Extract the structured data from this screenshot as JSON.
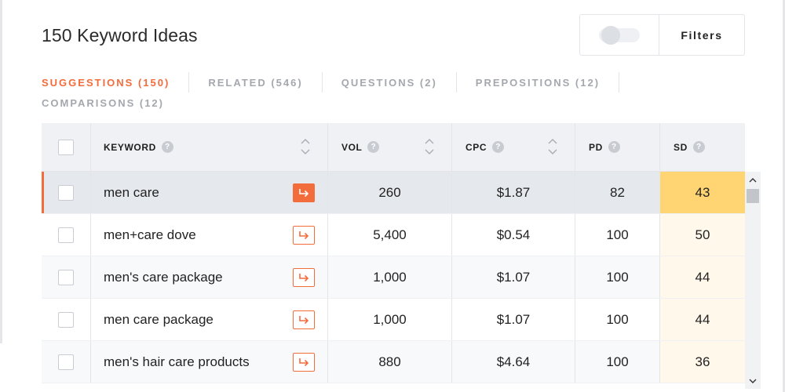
{
  "title": "150 Keyword Ideas",
  "filters": {
    "label": "Filters",
    "toggle_on": false
  },
  "tabs": [
    {
      "label": "SUGGESTIONS (150)",
      "active": true
    },
    {
      "label": "RELATED (546)",
      "active": false
    },
    {
      "label": "QUESTIONS (2)",
      "active": false
    },
    {
      "label": "PREPOSITIONS (12)",
      "active": false
    },
    {
      "label": "COMPARISONS (12)",
      "active": false
    }
  ],
  "table": {
    "headers": {
      "keyword": "KEYWORD",
      "vol": "VOL",
      "cpc": "CPC",
      "pd": "PD",
      "sd": "SD"
    },
    "rows": [
      {
        "keyword": "men care",
        "vol": "260",
        "cpc": "$1.87",
        "pd": "82",
        "sd": "43"
      },
      {
        "keyword": "men+care dove",
        "vol": "5,400",
        "cpc": "$0.54",
        "pd": "100",
        "sd": "50"
      },
      {
        "keyword": "men's care package",
        "vol": "1,000",
        "cpc": "$1.07",
        "pd": "100",
        "sd": "44"
      },
      {
        "keyword": "men care package",
        "vol": "1,000",
        "cpc": "$1.07",
        "pd": "100",
        "sd": "44"
      },
      {
        "keyword": "men's hair care products",
        "vol": "880",
        "cpc": "$4.64",
        "pd": "100",
        "sd": "36"
      }
    ]
  },
  "colors": {
    "accent": "#f26c3c",
    "sd_highlight": "#ffd472",
    "sd_light": "#fff8eb"
  },
  "icons": {
    "help": "question-circle-icon",
    "sort": "sort-chevrons-icon",
    "open": "arrow-corner-right-icon"
  }
}
